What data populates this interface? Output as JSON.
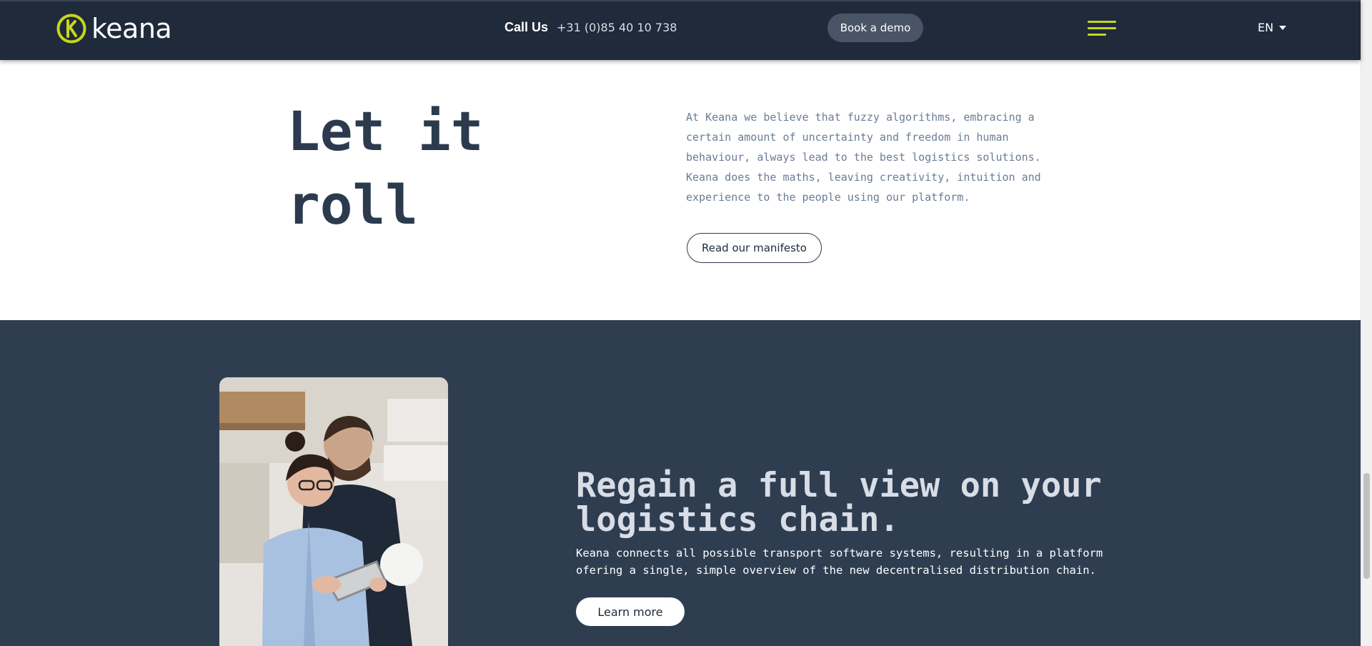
{
  "header": {
    "logo_text": "keana",
    "call_label": "Call Us",
    "phone": "+31 (0)85 40 10 738",
    "demo_button": "Book a demo",
    "menu_icon": "hamburger-menu-icon",
    "language": "EN"
  },
  "hero": {
    "title_line1": "Let it",
    "title_line2": "roll",
    "text": "At Keana we believe that fuzzy algorithms, embracing a certain amount of uncertainty and freedom in human behaviour, always lead to the best logistics solutions. Keana does the maths, leaving creativity, intuition and experience to the people using our platform.",
    "button": "Read our manifesto"
  },
  "section2": {
    "title": "Regain a full view on your logistics chain.",
    "text": "Keana connects all possible transport software systems, resulting in a platform ofering a single, simple overview of the new decentralised distribution chain.",
    "button": "Learn more"
  },
  "colors": {
    "header_bg": "#1f2a3b",
    "accent": "#c6d61c",
    "dark_section_bg": "#2f3d51",
    "title_dark": "#2c3a4e"
  }
}
